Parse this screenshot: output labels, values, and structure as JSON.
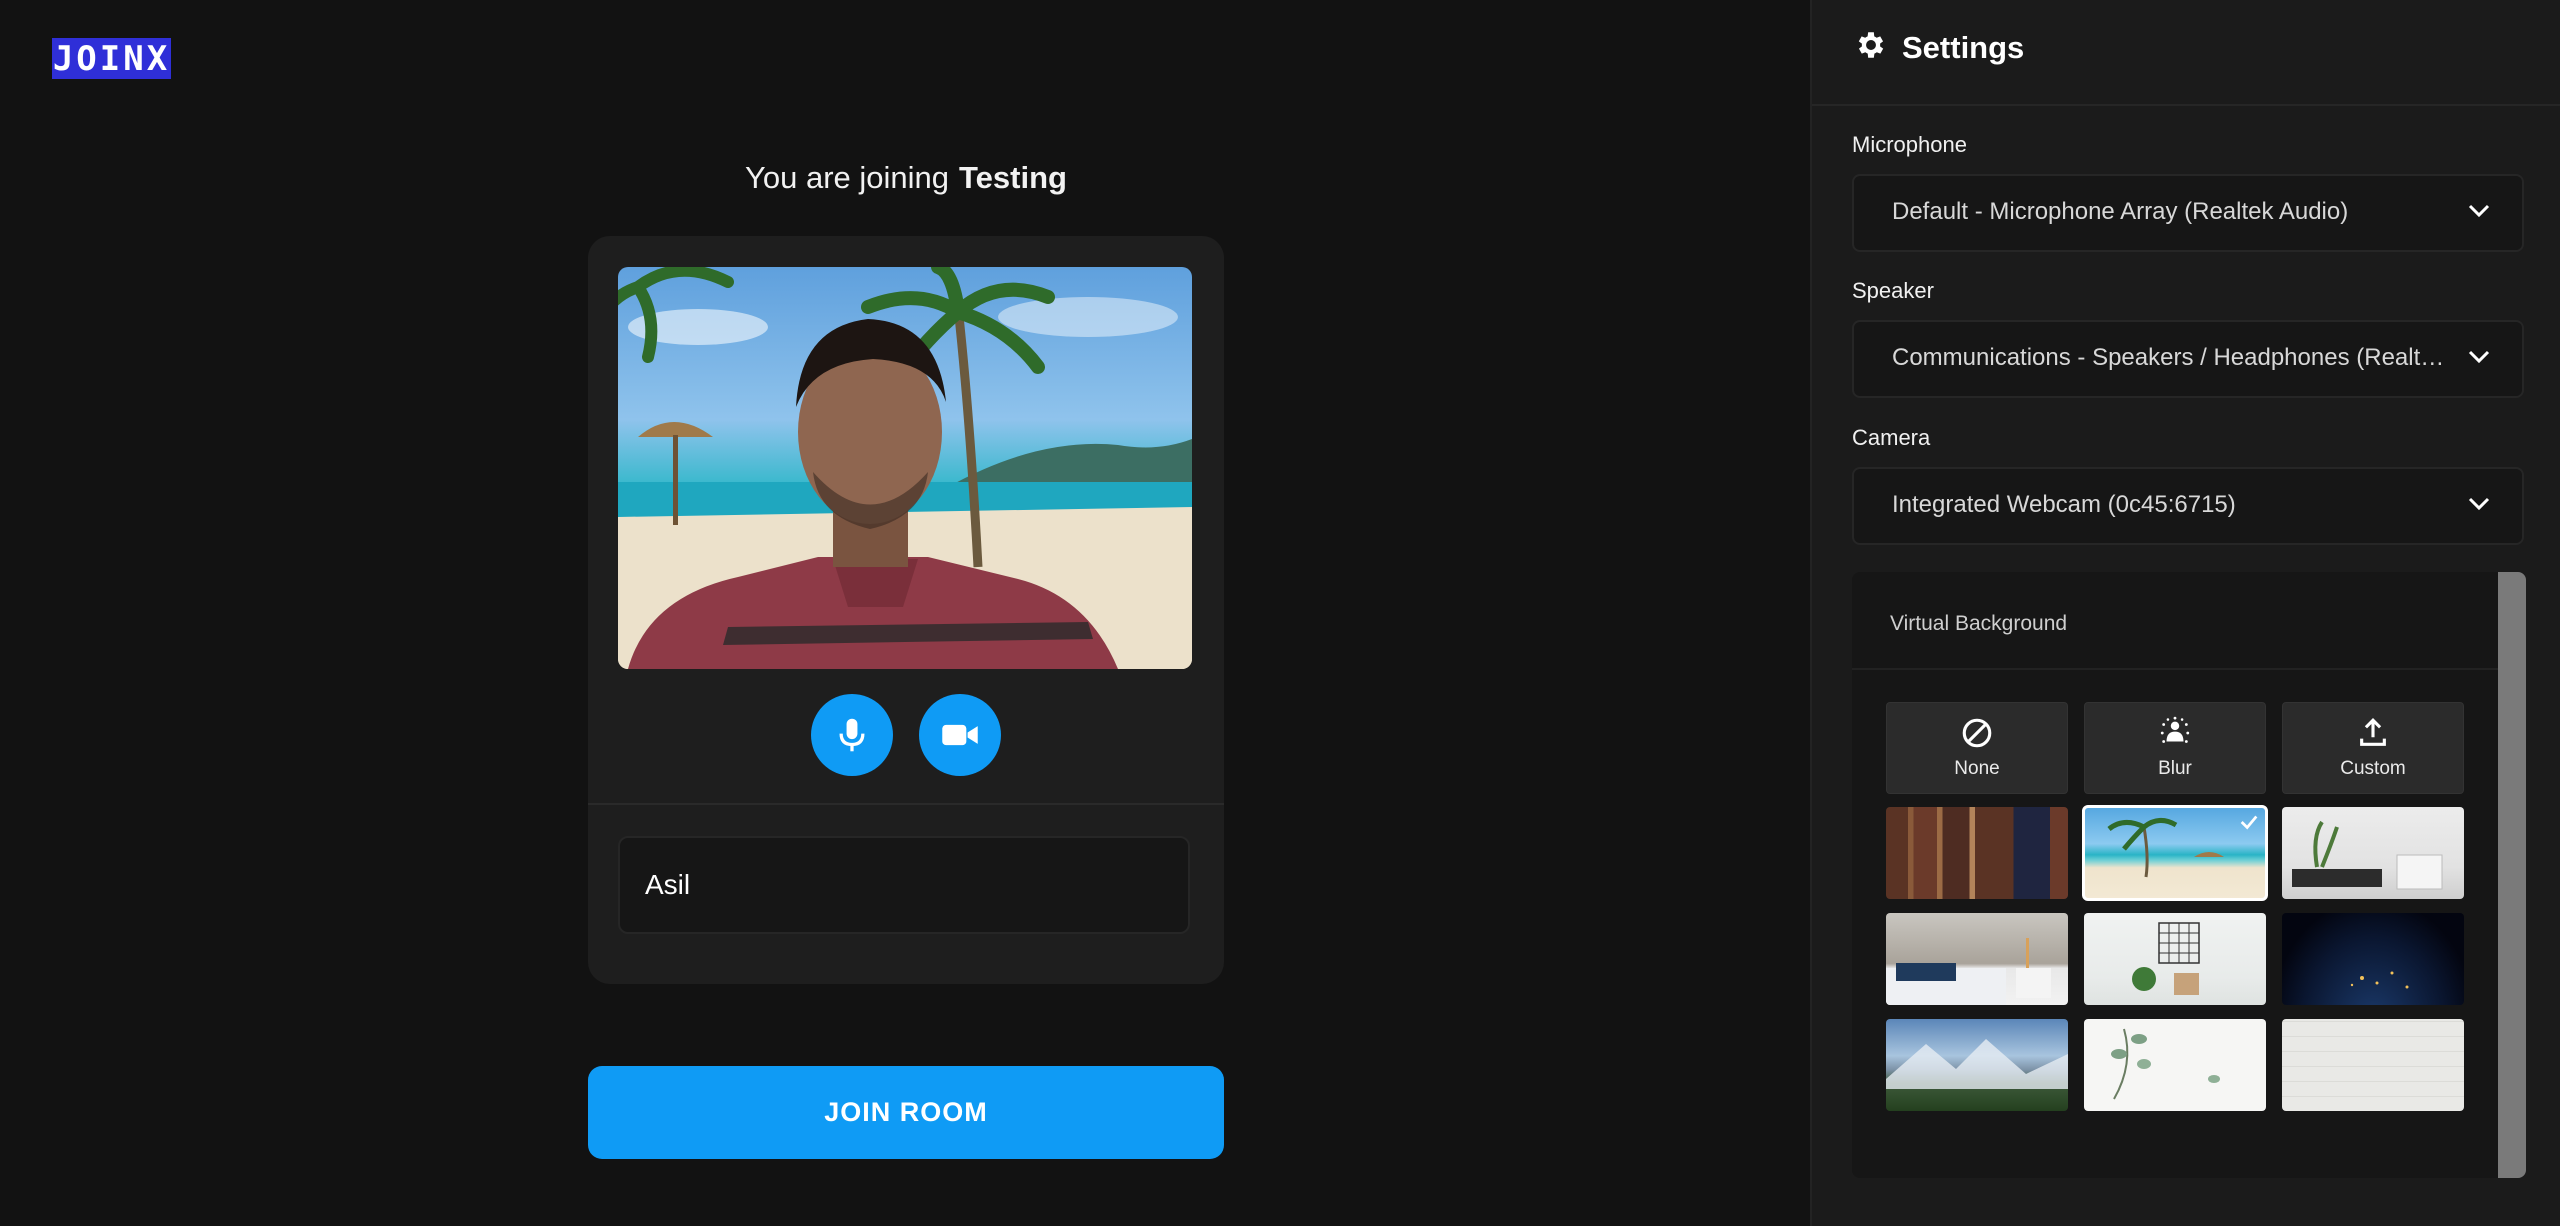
{
  "app": {
    "logo_text": "JOINX"
  },
  "join": {
    "prefix": "You are joining",
    "room": "Testing",
    "name_value": "Asil",
    "join_label": "JOIN ROOM"
  },
  "controls": {
    "mic_icon": "microphone-icon",
    "camera_icon": "video-camera-icon"
  },
  "settings": {
    "title": "Settings",
    "microphone": {
      "label": "Microphone",
      "value": "Default - Microphone Array (Realtek Audio)"
    },
    "speaker": {
      "label": "Speaker",
      "value": "Communications - Speakers / Headphones (Realtek Audio)"
    },
    "camera": {
      "label": "Camera",
      "value": "Integrated Webcam (0c45:6715)"
    },
    "virtual_background": {
      "title": "Virtual Background",
      "options": [
        {
          "label": "None",
          "icon": "prohibited-icon"
        },
        {
          "label": "Blur",
          "icon": "blur-icon"
        },
        {
          "label": "Custom",
          "icon": "upload-icon"
        }
      ],
      "thumbnails": [
        "bookshelf",
        "beach",
        "white-living-room",
        "bedroom",
        "plant-shelf",
        "earth-night",
        "mountains",
        "eucalyptus",
        "white-wall"
      ],
      "selected": "beach"
    }
  },
  "colors": {
    "accent": "#0f9bf5",
    "logo_bg": "#2f2fd8",
    "page_bg": "#121212",
    "panel_bg": "#1b1b1b"
  }
}
